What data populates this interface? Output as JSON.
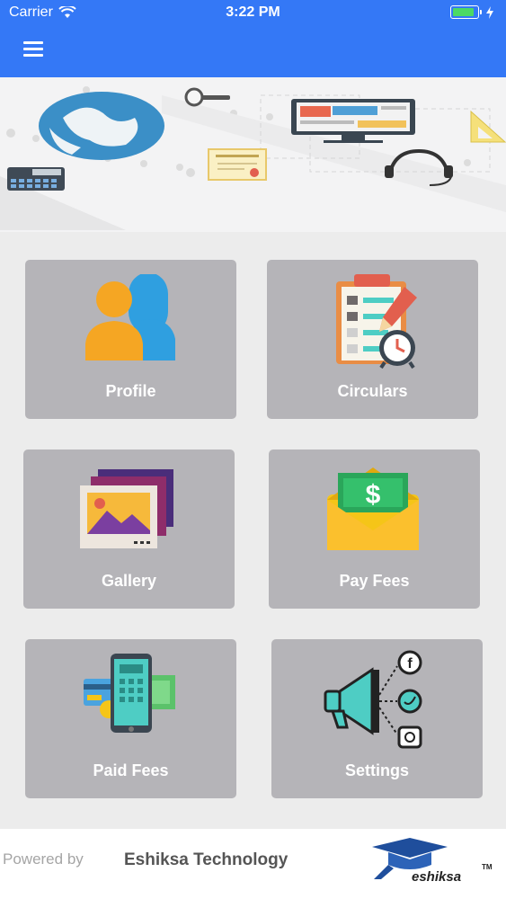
{
  "status_bar": {
    "carrier": "Carrier",
    "time": "3:22 PM"
  },
  "app_bar": {
    "menu_icon": "hamburger-menu-icon"
  },
  "tiles": [
    {
      "label": "Profile",
      "icon": "profile-icon"
    },
    {
      "label": "Circulars",
      "icon": "circulars-icon"
    },
    {
      "label": "Gallery",
      "icon": "gallery-icon"
    },
    {
      "label": "Pay Fees",
      "icon": "pay-fees-icon"
    },
    {
      "label": "Paid Fees",
      "icon": "paid-fees-icon"
    },
    {
      "label": "Settings",
      "icon": "settings-icon"
    }
  ],
  "footer": {
    "powered_by": "Powered by",
    "company": "Eshiksa Technology",
    "logo_text": "eshiksa",
    "logo_tm": "TM"
  },
  "colors": {
    "app_bar": "#3478f6",
    "tile": "#b5b4b8",
    "background": "#ececec"
  }
}
